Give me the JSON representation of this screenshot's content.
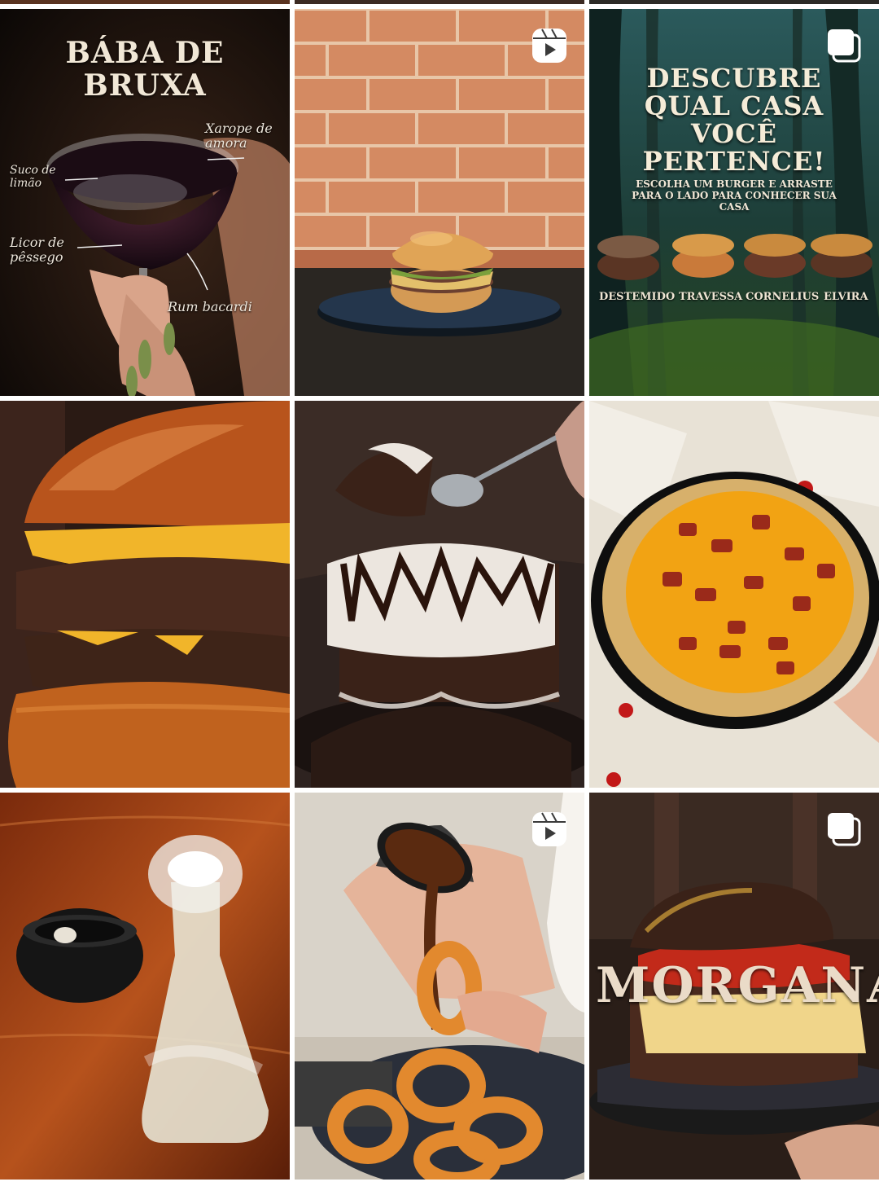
{
  "colors": {
    "background": "#ffffff",
    "badge": "#ffffff"
  },
  "grid": {
    "tiles": [
      {
        "kind": "image",
        "title_lines": [
          "BÁBA DE",
          "BRUXA"
        ],
        "notes": [
          "Xarope de amora",
          "Suco de limão",
          "Licor de pêssego",
          "Rum bacardi"
        ]
      },
      {
        "kind": "reel",
        "badge_icon": "reel-icon"
      },
      {
        "kind": "carousel",
        "badge_icon": "carousel-icon",
        "title_lines": [
          "DESCUBRE",
          "QUAL CASA VOCÊ",
          "PERTENCE!"
        ],
        "subtitle": "ESCOLHA UM BURGER E ARRASTE PARA O LADO PARA CONHECER SUA CASA",
        "burgers": [
          "DESTEMIDO",
          "TRAVESSA",
          "CORNELIUS",
          "ELVIRA"
        ]
      },
      {
        "kind": "image"
      },
      {
        "kind": "image"
      },
      {
        "kind": "image"
      },
      {
        "kind": "image"
      },
      {
        "kind": "reel",
        "badge_icon": "reel-icon"
      },
      {
        "kind": "carousel",
        "badge_icon": "carousel-icon",
        "title_lines": [
          "MORGANA"
        ]
      }
    ]
  }
}
